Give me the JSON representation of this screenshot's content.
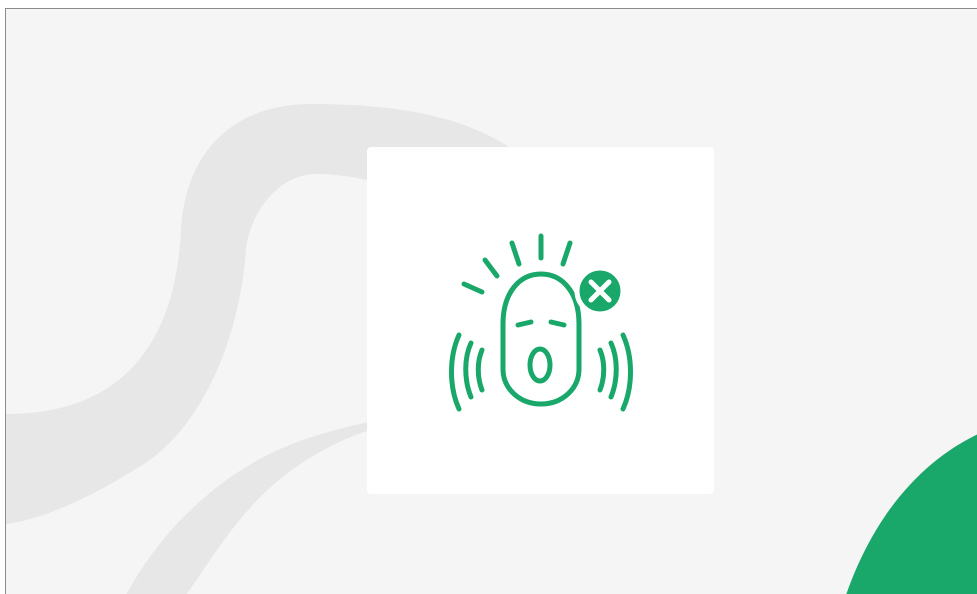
{
  "colors": {
    "page_background": "#f5f5f5",
    "decorative_shape": "#e7e7e7",
    "accent_green": "#19a76a",
    "card_background": "#ffffff",
    "border": "#8c8c8c"
  },
  "illustration": {
    "icon": "alarm-error-icon",
    "badge_icon": "close-icon",
    "accent": "#19a76a"
  }
}
